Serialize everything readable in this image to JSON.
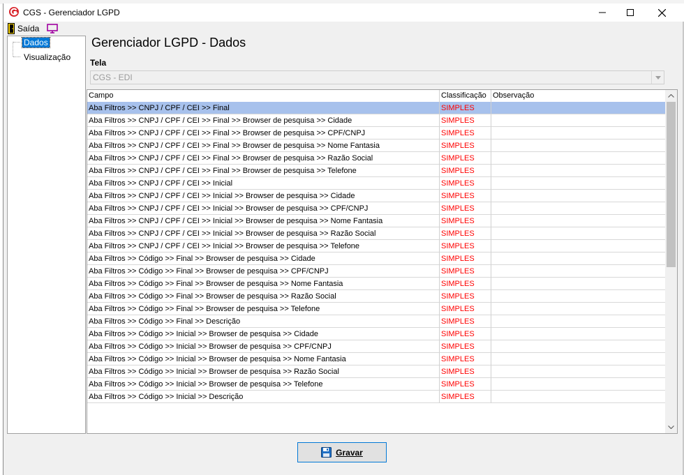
{
  "window": {
    "title": "CGS - Gerenciador LGPD",
    "controls": {
      "minimize": "—",
      "maximize": "☐",
      "close": "✕"
    }
  },
  "menu": {
    "exit_label": "Saída",
    "exit_icon": "exit-door-icon",
    "screen_icon": "monitor-icon"
  },
  "tree": {
    "items": [
      {
        "label": "Dados",
        "selected": true
      },
      {
        "label": "Visualização",
        "selected": false
      }
    ]
  },
  "main": {
    "title": "Gerenciador LGPD - Dados",
    "tela_label": "Tela",
    "tela_value": "CGS - EDI"
  },
  "grid": {
    "columns": [
      "Campo",
      "Classificação",
      "Observação"
    ],
    "rows": [
      {
        "campo": "Aba Filtros >> CNPJ / CPF / CEI >> Final",
        "classificacao": "SIMPLES",
        "observacao": ""
      },
      {
        "campo": "Aba Filtros >> CNPJ / CPF / CEI >> Final >> Browser de pesquisa >> Cidade",
        "classificacao": "SIMPLES",
        "observacao": ""
      },
      {
        "campo": "Aba Filtros >> CNPJ / CPF / CEI >> Final >> Browser de pesquisa >> CPF/CNPJ",
        "classificacao": "SIMPLES",
        "observacao": ""
      },
      {
        "campo": "Aba Filtros >> CNPJ / CPF / CEI >> Final >> Browser de pesquisa >> Nome Fantasia",
        "classificacao": "SIMPLES",
        "observacao": ""
      },
      {
        "campo": "Aba Filtros >> CNPJ / CPF / CEI >> Final >> Browser de pesquisa >> Razão Social",
        "classificacao": "SIMPLES",
        "observacao": ""
      },
      {
        "campo": "Aba Filtros >> CNPJ / CPF / CEI >> Final >> Browser de pesquisa >> Telefone",
        "classificacao": "SIMPLES",
        "observacao": ""
      },
      {
        "campo": "Aba Filtros >> CNPJ / CPF / CEI >> Inicial",
        "classificacao": "SIMPLES",
        "observacao": ""
      },
      {
        "campo": "Aba Filtros >> CNPJ / CPF / CEI >> Inicial >> Browser de pesquisa >> Cidade",
        "classificacao": "SIMPLES",
        "observacao": ""
      },
      {
        "campo": "Aba Filtros >> CNPJ / CPF / CEI >> Inicial >> Browser de pesquisa >> CPF/CNPJ",
        "classificacao": "SIMPLES",
        "observacao": ""
      },
      {
        "campo": "Aba Filtros >> CNPJ / CPF / CEI >> Inicial >> Browser de pesquisa >> Nome Fantasia",
        "classificacao": "SIMPLES",
        "observacao": ""
      },
      {
        "campo": "Aba Filtros >> CNPJ / CPF / CEI >> Inicial >> Browser de pesquisa >> Razão Social",
        "classificacao": "SIMPLES",
        "observacao": ""
      },
      {
        "campo": "Aba Filtros >> CNPJ / CPF / CEI >> Inicial >> Browser de pesquisa >> Telefone",
        "classificacao": "SIMPLES",
        "observacao": ""
      },
      {
        "campo": "Aba Filtros >> Código >> Final >> Browser de pesquisa >> Cidade",
        "classificacao": "SIMPLES",
        "observacao": ""
      },
      {
        "campo": "Aba Filtros >> Código >> Final >> Browser de pesquisa >> CPF/CNPJ",
        "classificacao": "SIMPLES",
        "observacao": ""
      },
      {
        "campo": "Aba Filtros >> Código >> Final >> Browser de pesquisa >> Nome Fantasia",
        "classificacao": "SIMPLES",
        "observacao": ""
      },
      {
        "campo": "Aba Filtros >> Código >> Final >> Browser de pesquisa >> Razão Social",
        "classificacao": "SIMPLES",
        "observacao": ""
      },
      {
        "campo": "Aba Filtros >> Código >> Final >> Browser de pesquisa >> Telefone",
        "classificacao": "SIMPLES",
        "observacao": ""
      },
      {
        "campo": "Aba Filtros >> Código >> Final >> Descrição",
        "classificacao": "SIMPLES",
        "observacao": ""
      },
      {
        "campo": "Aba Filtros >> Código >> Inicial >> Browser de pesquisa >> Cidade",
        "classificacao": "SIMPLES",
        "observacao": ""
      },
      {
        "campo": "Aba Filtros >> Código >> Inicial >> Browser de pesquisa >> CPF/CNPJ",
        "classificacao": "SIMPLES",
        "observacao": ""
      },
      {
        "campo": "Aba Filtros >> Código >> Inicial >> Browser de pesquisa >> Nome Fantasia",
        "classificacao": "SIMPLES",
        "observacao": ""
      },
      {
        "campo": "Aba Filtros >> Código >> Inicial >> Browser de pesquisa >> Razão Social",
        "classificacao": "SIMPLES",
        "observacao": ""
      },
      {
        "campo": "Aba Filtros >> Código >> Inicial >> Browser de pesquisa >> Telefone",
        "classificacao": "SIMPLES",
        "observacao": ""
      },
      {
        "campo": "Aba Filtros >> Código >> Inicial >> Descrição",
        "classificacao": "SIMPLES",
        "observacao": ""
      }
    ],
    "selected_row": 0
  },
  "footer": {
    "save_label": "Gravar",
    "save_icon": "floppy-disk-icon"
  },
  "colors": {
    "selection": "#a7c1ec",
    "classification_text": "#ff0000",
    "tree_selection": "#0078d7",
    "accent": "#0078d7"
  }
}
